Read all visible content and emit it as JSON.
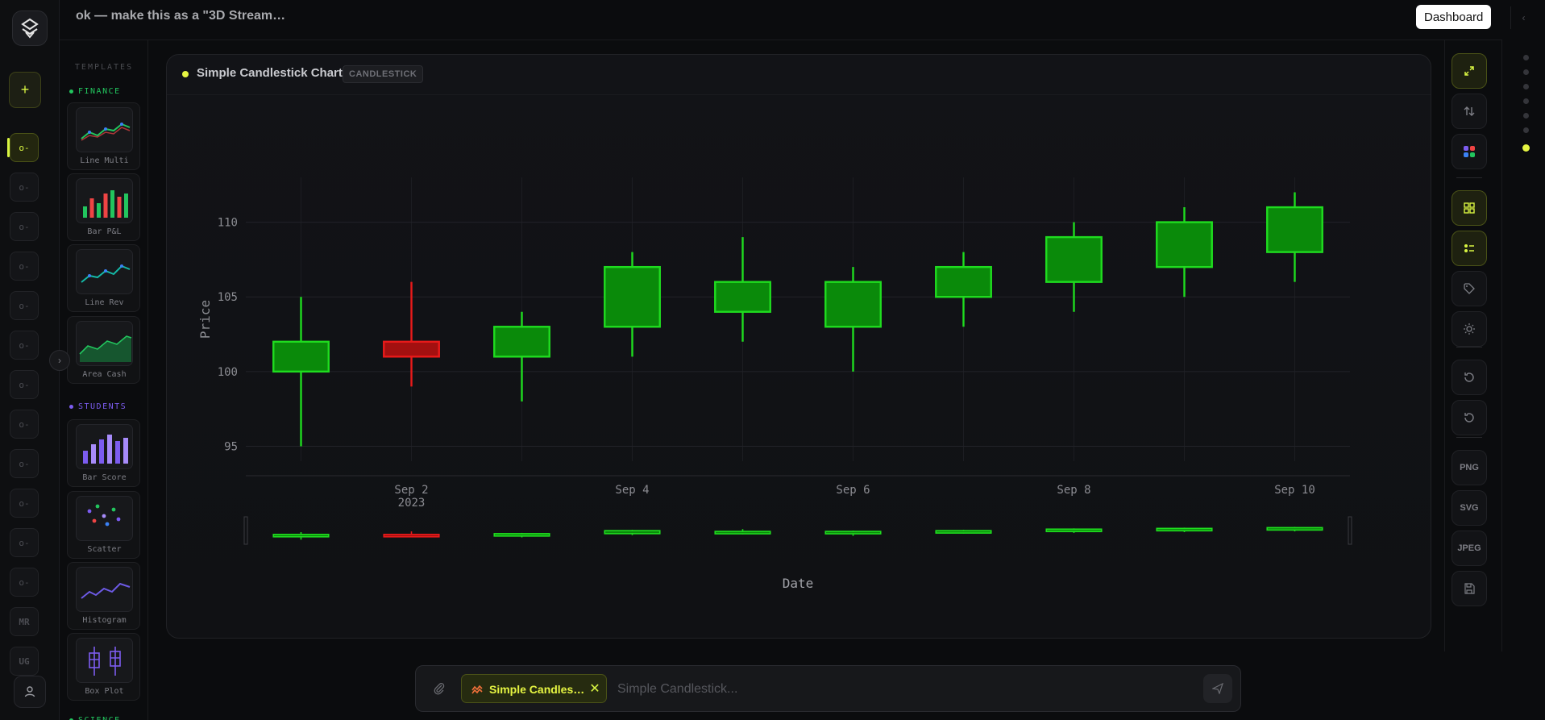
{
  "topbar": {
    "title": "ok — make this as a \"3D Stream…",
    "dashboard_label": "Dashboard",
    "collapse_icon": "chevron-left-icon"
  },
  "rail": {
    "new_label": "+",
    "slots": [
      "o-",
      "o-",
      "o-",
      "o-",
      "o-",
      "o-",
      "o-",
      "o-",
      "o-",
      "o-",
      "o-",
      "o-"
    ],
    "badges": [
      "MR",
      "UG"
    ],
    "toggle": "›"
  },
  "templates": {
    "title": "TEMPLATES",
    "categories": [
      {
        "name": "FINANCE",
        "color": "#22c55e",
        "items": [
          {
            "label": "Line Multi"
          },
          {
            "label": "Bar P&L"
          },
          {
            "label": "Line Rev"
          },
          {
            "label": "Area Cash"
          }
        ]
      },
      {
        "name": "STUDENTS",
        "color": "#7c5cf0",
        "items": [
          {
            "label": "Bar Score"
          },
          {
            "label": "Scatter"
          },
          {
            "label": "Histogram"
          },
          {
            "label": "Box Plot"
          }
        ]
      },
      {
        "name": "SCIENCE",
        "color": "#22c55e",
        "items": []
      }
    ]
  },
  "card": {
    "title": "Simple Candlestick Chart",
    "badge": "CANDLESTICK"
  },
  "chart_data": {
    "type": "candlestick",
    "title": "",
    "xlabel": "Date",
    "ylabel": "Price",
    "x_ticks": [
      "Sep 2",
      "Sep 4",
      "Sep 6",
      "Sep 8",
      "Sep 10"
    ],
    "x_tick_sub": "2023",
    "y_ticks": [
      95,
      100,
      105,
      110
    ],
    "ylim": [
      94,
      113
    ],
    "increasing_color": "#1fdc1f",
    "decreasing_color": "#e81a1a",
    "candles": [
      {
        "date": "2023-09-01",
        "open": 100,
        "high": 105,
        "low": 95,
        "close": 102
      },
      {
        "date": "2023-09-02",
        "open": 102,
        "high": 106,
        "low": 99,
        "close": 101
      },
      {
        "date": "2023-09-03",
        "open": 101,
        "high": 104,
        "low": 98,
        "close": 103
      },
      {
        "date": "2023-09-04",
        "open": 103,
        "high": 108,
        "low": 101,
        "close": 107
      },
      {
        "date": "2023-09-05",
        "open": 104,
        "high": 109,
        "low": 102,
        "close": 106
      },
      {
        "date": "2023-09-06",
        "open": 103,
        "high": 107,
        "low": 100,
        "close": 106
      },
      {
        "date": "2023-09-07",
        "open": 105,
        "high": 108,
        "low": 103,
        "close": 107
      },
      {
        "date": "2023-09-08",
        "open": 106,
        "high": 110,
        "low": 104,
        "close": 109
      },
      {
        "date": "2023-09-09",
        "open": 107,
        "high": 111,
        "low": 105,
        "close": 110
      },
      {
        "date": "2023-09-10",
        "open": 108,
        "high": 112,
        "low": 106,
        "close": 111
      }
    ],
    "grid": true,
    "range_slider": true
  },
  "tools": {
    "items": [
      {
        "name": "expand-icon",
        "text": ""
      },
      {
        "name": "swap-axes-icon",
        "text": ""
      },
      {
        "name": "palette-icon",
        "text": ""
      },
      {
        "name": "grid-icon",
        "text": ""
      },
      {
        "name": "legend-icon",
        "text": ""
      },
      {
        "name": "tag-icon",
        "text": ""
      },
      {
        "name": "theme-icon",
        "text": ""
      },
      {
        "name": "undo-icon",
        "text": ""
      },
      {
        "name": "reset-icon",
        "text": ""
      },
      {
        "name": "png-export",
        "text": "PNG"
      },
      {
        "name": "svg-export",
        "text": "SVG"
      },
      {
        "name": "jpeg-export",
        "text": "JPEG"
      },
      {
        "name": "save-icon",
        "text": ""
      }
    ]
  },
  "composer": {
    "chip_label": "Simple Candles…",
    "placeholder": "Simple Candlestick..."
  },
  "accent": "#d9f542"
}
